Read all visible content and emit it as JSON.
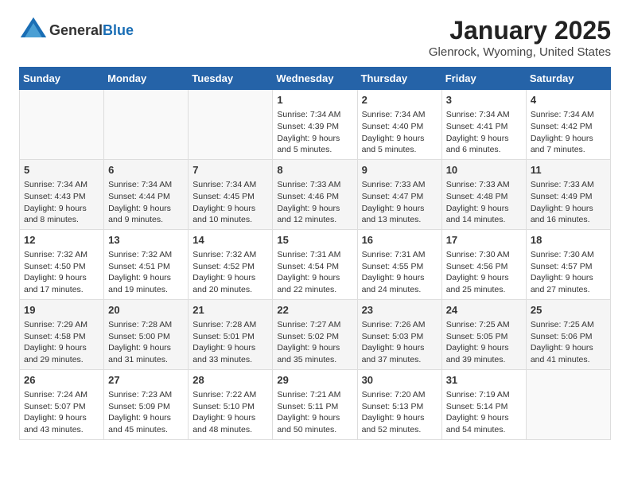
{
  "header": {
    "logo_general": "General",
    "logo_blue": "Blue",
    "month": "January 2025",
    "location": "Glenrock, Wyoming, United States"
  },
  "days_of_week": [
    "Sunday",
    "Monday",
    "Tuesday",
    "Wednesday",
    "Thursday",
    "Friday",
    "Saturday"
  ],
  "weeks": [
    [
      {
        "day": null,
        "data": null
      },
      {
        "day": null,
        "data": null
      },
      {
        "day": null,
        "data": null
      },
      {
        "day": "1",
        "data": {
          "sunrise": "7:34 AM",
          "sunset": "4:39 PM",
          "daylight": "9 hours and 5 minutes."
        }
      },
      {
        "day": "2",
        "data": {
          "sunrise": "7:34 AM",
          "sunset": "4:40 PM",
          "daylight": "9 hours and 5 minutes."
        }
      },
      {
        "day": "3",
        "data": {
          "sunrise": "7:34 AM",
          "sunset": "4:41 PM",
          "daylight": "9 hours and 6 minutes."
        }
      },
      {
        "day": "4",
        "data": {
          "sunrise": "7:34 AM",
          "sunset": "4:42 PM",
          "daylight": "9 hours and 7 minutes."
        }
      }
    ],
    [
      {
        "day": "5",
        "data": {
          "sunrise": "7:34 AM",
          "sunset": "4:43 PM",
          "daylight": "9 hours and 8 minutes."
        }
      },
      {
        "day": "6",
        "data": {
          "sunrise": "7:34 AM",
          "sunset": "4:44 PM",
          "daylight": "9 hours and 9 minutes."
        }
      },
      {
        "day": "7",
        "data": {
          "sunrise": "7:34 AM",
          "sunset": "4:45 PM",
          "daylight": "9 hours and 10 minutes."
        }
      },
      {
        "day": "8",
        "data": {
          "sunrise": "7:33 AM",
          "sunset": "4:46 PM",
          "daylight": "9 hours and 12 minutes."
        }
      },
      {
        "day": "9",
        "data": {
          "sunrise": "7:33 AM",
          "sunset": "4:47 PM",
          "daylight": "9 hours and 13 minutes."
        }
      },
      {
        "day": "10",
        "data": {
          "sunrise": "7:33 AM",
          "sunset": "4:48 PM",
          "daylight": "9 hours and 14 minutes."
        }
      },
      {
        "day": "11",
        "data": {
          "sunrise": "7:33 AM",
          "sunset": "4:49 PM",
          "daylight": "9 hours and 16 minutes."
        }
      }
    ],
    [
      {
        "day": "12",
        "data": {
          "sunrise": "7:32 AM",
          "sunset": "4:50 PM",
          "daylight": "9 hours and 17 minutes."
        }
      },
      {
        "day": "13",
        "data": {
          "sunrise": "7:32 AM",
          "sunset": "4:51 PM",
          "daylight": "9 hours and 19 minutes."
        }
      },
      {
        "day": "14",
        "data": {
          "sunrise": "7:32 AM",
          "sunset": "4:52 PM",
          "daylight": "9 hours and 20 minutes."
        }
      },
      {
        "day": "15",
        "data": {
          "sunrise": "7:31 AM",
          "sunset": "4:54 PM",
          "daylight": "9 hours and 22 minutes."
        }
      },
      {
        "day": "16",
        "data": {
          "sunrise": "7:31 AM",
          "sunset": "4:55 PM",
          "daylight": "9 hours and 24 minutes."
        }
      },
      {
        "day": "17",
        "data": {
          "sunrise": "7:30 AM",
          "sunset": "4:56 PM",
          "daylight": "9 hours and 25 minutes."
        }
      },
      {
        "day": "18",
        "data": {
          "sunrise": "7:30 AM",
          "sunset": "4:57 PM",
          "daylight": "9 hours and 27 minutes."
        }
      }
    ],
    [
      {
        "day": "19",
        "data": {
          "sunrise": "7:29 AM",
          "sunset": "4:58 PM",
          "daylight": "9 hours and 29 minutes."
        }
      },
      {
        "day": "20",
        "data": {
          "sunrise": "7:28 AM",
          "sunset": "5:00 PM",
          "daylight": "9 hours and 31 minutes."
        }
      },
      {
        "day": "21",
        "data": {
          "sunrise": "7:28 AM",
          "sunset": "5:01 PM",
          "daylight": "9 hours and 33 minutes."
        }
      },
      {
        "day": "22",
        "data": {
          "sunrise": "7:27 AM",
          "sunset": "5:02 PM",
          "daylight": "9 hours and 35 minutes."
        }
      },
      {
        "day": "23",
        "data": {
          "sunrise": "7:26 AM",
          "sunset": "5:03 PM",
          "daylight": "9 hours and 37 minutes."
        }
      },
      {
        "day": "24",
        "data": {
          "sunrise": "7:25 AM",
          "sunset": "5:05 PM",
          "daylight": "9 hours and 39 minutes."
        }
      },
      {
        "day": "25",
        "data": {
          "sunrise": "7:25 AM",
          "sunset": "5:06 PM",
          "daylight": "9 hours and 41 minutes."
        }
      }
    ],
    [
      {
        "day": "26",
        "data": {
          "sunrise": "7:24 AM",
          "sunset": "5:07 PM",
          "daylight": "9 hours and 43 minutes."
        }
      },
      {
        "day": "27",
        "data": {
          "sunrise": "7:23 AM",
          "sunset": "5:09 PM",
          "daylight": "9 hours and 45 minutes."
        }
      },
      {
        "day": "28",
        "data": {
          "sunrise": "7:22 AM",
          "sunset": "5:10 PM",
          "daylight": "9 hours and 48 minutes."
        }
      },
      {
        "day": "29",
        "data": {
          "sunrise": "7:21 AM",
          "sunset": "5:11 PM",
          "daylight": "9 hours and 50 minutes."
        }
      },
      {
        "day": "30",
        "data": {
          "sunrise": "7:20 AM",
          "sunset": "5:13 PM",
          "daylight": "9 hours and 52 minutes."
        }
      },
      {
        "day": "31",
        "data": {
          "sunrise": "7:19 AM",
          "sunset": "5:14 PM",
          "daylight": "9 hours and 54 minutes."
        }
      },
      {
        "day": null,
        "data": null
      }
    ]
  ],
  "labels": {
    "sunrise": "Sunrise:",
    "sunset": "Sunset:",
    "daylight": "Daylight hours"
  }
}
